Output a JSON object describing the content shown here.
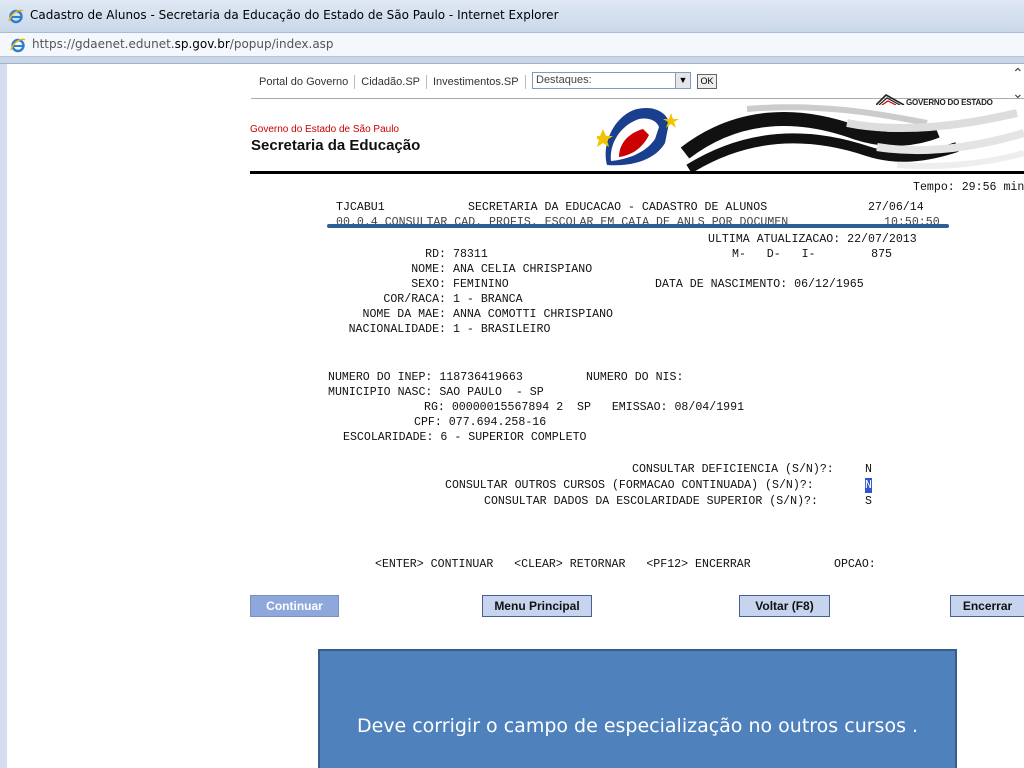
{
  "window": {
    "title": "Cadastro de Alunos - Secretaria da Educação do Estado de São Paulo - Internet Explorer",
    "url_prefix": "https://gdaenet.edunet.",
    "url_domain": "sp.gov.br",
    "url_path": "/popup/index.asp"
  },
  "portal_nav": {
    "links": [
      "Portal do Governo",
      "Cidadão.SP",
      "Investimentos.SP"
    ],
    "destaques_placeholder": "Destaques:",
    "ok_label": "OK",
    "gov_logo_text": "GOVERNO DO ESTADO"
  },
  "header": {
    "gov_subtitle": "Governo do Estado de São Paulo",
    "secretaria": "Secretaria da Educação"
  },
  "terminal": {
    "tempo": "Tempo: 29:56 min",
    "program": "TJCABU1",
    "system_title": "SECRETARIA DA EDUCACAO - CADASTRO DE ALUNOS",
    "date": "27/06/14",
    "line2": "00.0.4 CONSULTAR CAD. PROFIS. ESCOLAR EM CAIA DE ANLS POR DOCUMEN",
    "time": "10:50:50",
    "ultima_atualizacao": "ULTIMA ATUALIZACAO: 22/07/2013",
    "mdi_line": "M-   D-   I-        875",
    "fields": [
      {
        "label": "RD:",
        "value": "78311"
      },
      {
        "label": "NOME:",
        "value": "ANA CELIA CHRISPIANO"
      },
      {
        "label": "SEXO:",
        "value": "FEMININO"
      },
      {
        "label": "COR/RACA:",
        "value": "1 - BRANCA"
      },
      {
        "label": "NOME DA MAE:",
        "value": "ANNA COMOTTI CHRISPIANO"
      },
      {
        "label": "NACIONALIDADE:",
        "value": "1 - BRASILEIRO"
      }
    ],
    "data_nascimento": "DATA DE NASCIMENTO: 06/12/1965",
    "numero_inep": "NUMERO DO INEP: 118736419663",
    "numero_nis": "NUMERO DO NIS:",
    "municipio": "MUNICIPIO NASC: SAO PAULO  - SP",
    "rg": "RG: 00000015567894 2  SP   EMISSAO: 08/04/1991",
    "cpf": "CPF: 077.694.258-16",
    "escolaridade": "ESCOLARIDADE: 6 - SUPERIOR COMPLETO",
    "consultar_deficiencia": "CONSULTAR DEFICIENCIA (S/N)?:",
    "deficiencia_value": "N",
    "consultar_outros_cursos": "CONSULTAR OUTROS CURSOS (FORMACAO CONTINUADA) (S/N)?:",
    "outros_cursos_value": "N",
    "consultar_escolaridade": "CONSULTAR DADOS DA ESCOLARIDADE SUPERIOR (S/N)?:",
    "escolaridade_value": "S",
    "footer_keys": "<ENTER> CONTINUAR   <CLEAR> RETORNAR   <PF12> ENCERRAR",
    "opcao": "OPCAO:"
  },
  "buttons": {
    "continuar": "Continuar",
    "menu_principal": "Menu Principal",
    "voltar": "Voltar (F8)",
    "encerrar": "Encerrar"
  },
  "callout": {
    "text": "Deve corrigir o campo de especialização no outros cursos ."
  },
  "colors": {
    "callout_fill": "#4f81bd",
    "button_fill": "#c6d4f0",
    "accent_red": "#cc0000"
  }
}
